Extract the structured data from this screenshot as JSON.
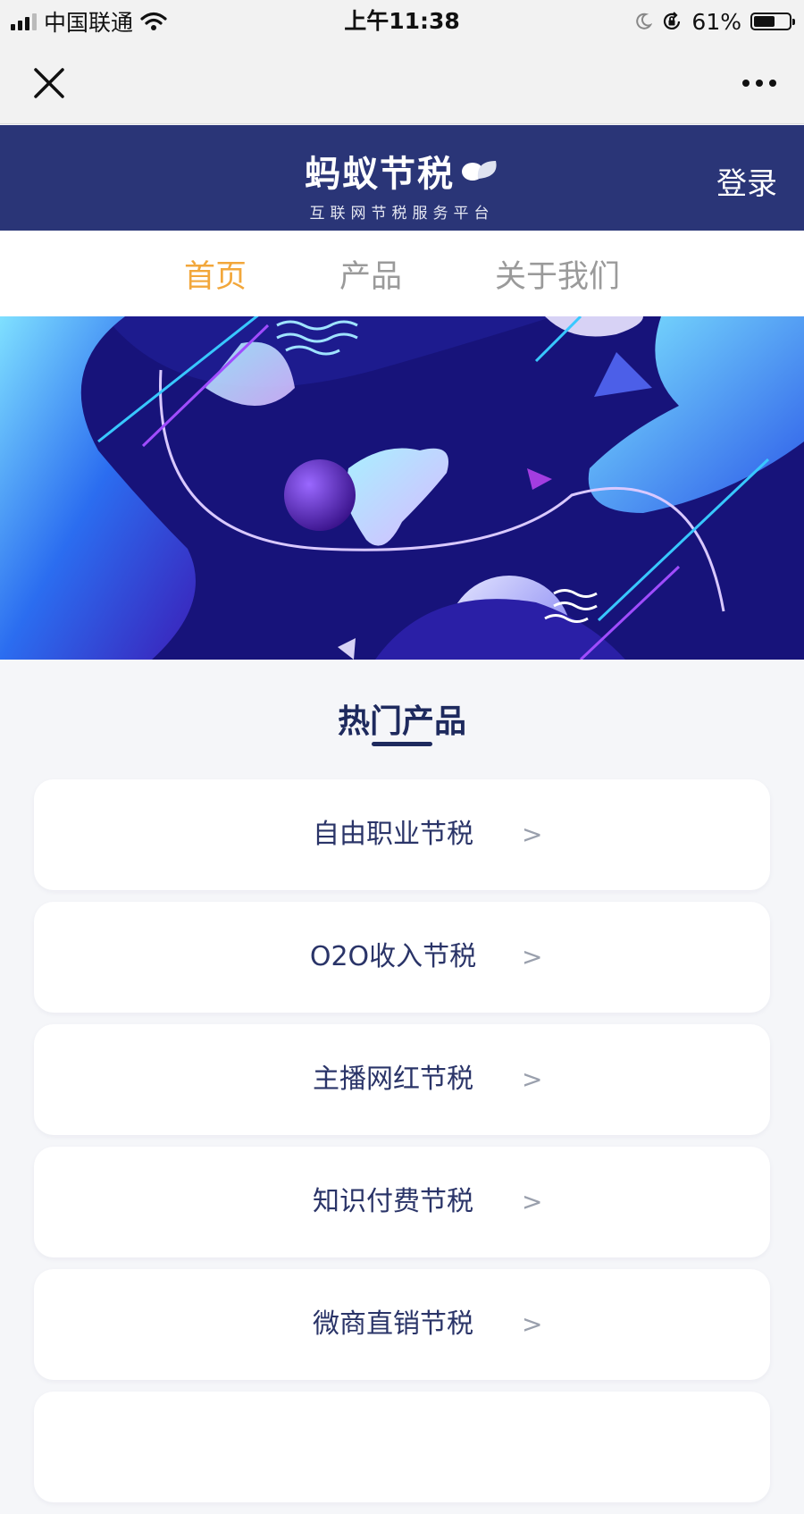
{
  "status_bar": {
    "carrier": "中国联通",
    "time": "上午11:38",
    "battery": "61%",
    "battery_level": 0.61
  },
  "brand": {
    "name": "蚂蚁节税",
    "tagline": "互联网节税服务平台",
    "login_label": "登录"
  },
  "tabs": [
    {
      "label": "首页",
      "active": true
    },
    {
      "label": "产品",
      "active": false
    },
    {
      "label": "关于我们",
      "active": false
    }
  ],
  "section": {
    "title": "热门产品"
  },
  "products": [
    {
      "label": "自由职业节税",
      "arrow": ">"
    },
    {
      "label": "O2O收入节税",
      "arrow": ">"
    },
    {
      "label": "主播网红节税",
      "arrow": ">"
    },
    {
      "label": "知识付费节税",
      "arrow": ">"
    },
    {
      "label": "微商直销节税",
      "arrow": ">"
    }
  ],
  "colors": {
    "brand_bar": "#2a3577",
    "active_tab": "#f2a73b",
    "product_text": "#2a3468"
  },
  "icons": [
    "signal-icon",
    "wifi-icon",
    "moon-icon",
    "orientation-lock-icon",
    "battery-icon",
    "close-icon",
    "more-icon",
    "leaf-logo-icon",
    "chevron-right-icon"
  ]
}
